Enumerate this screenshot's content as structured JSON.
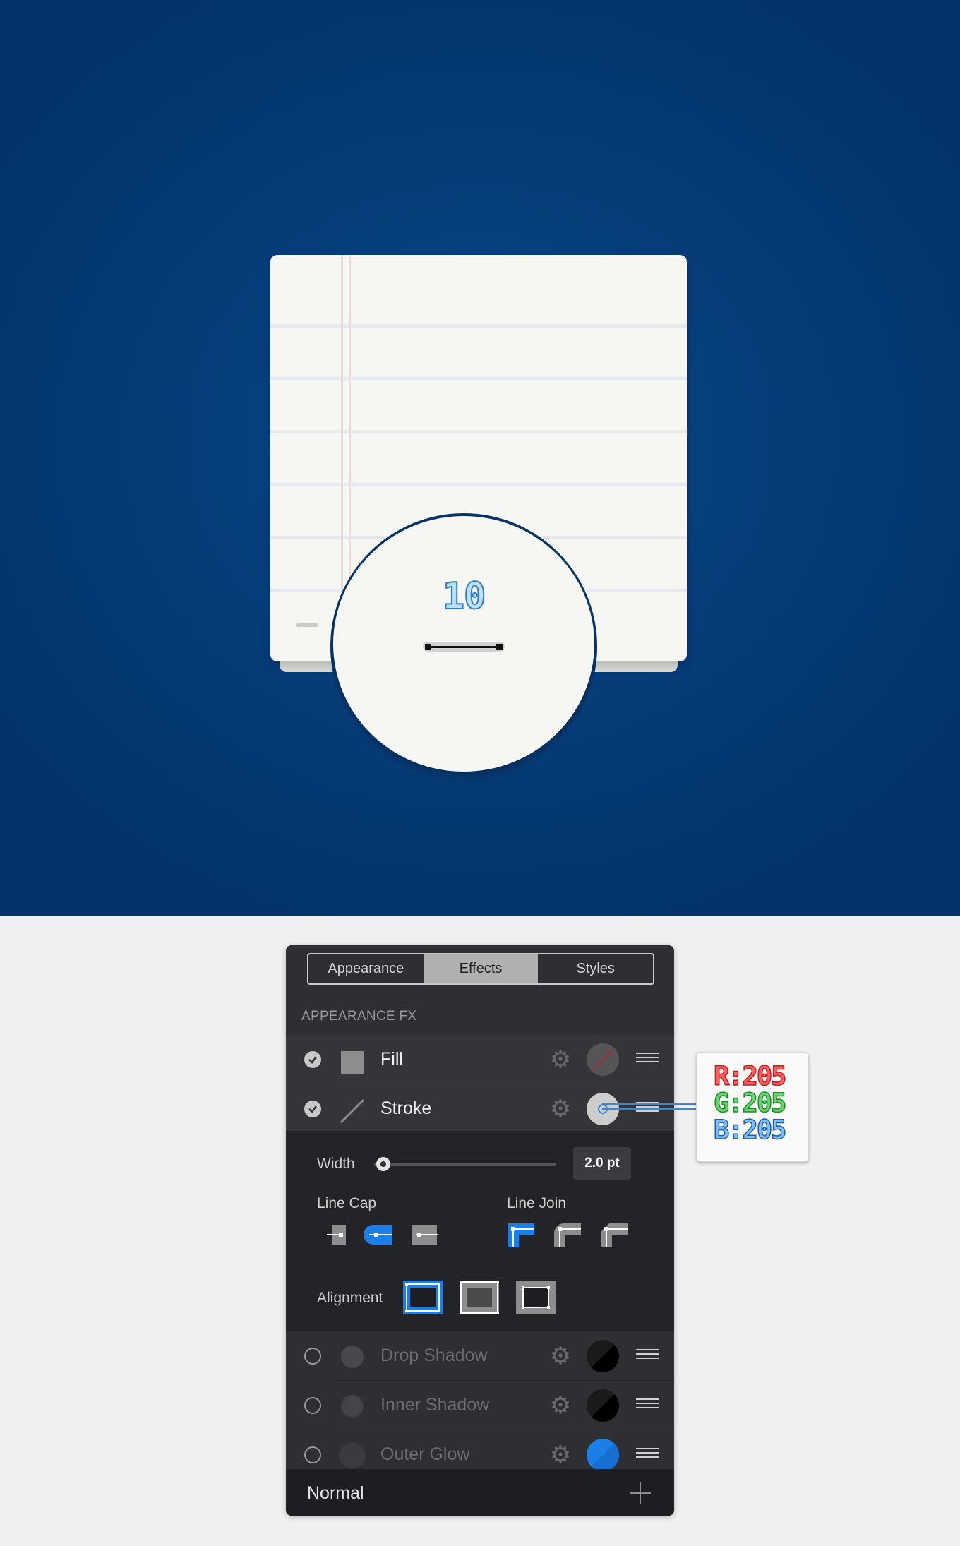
{
  "canvas": {
    "magnifier_value": "10"
  },
  "panel": {
    "tabs": [
      {
        "label": "Appearance",
        "active": false
      },
      {
        "label": "Effects",
        "active": true
      },
      {
        "label": "Styles",
        "active": false
      }
    ],
    "section_label": "APPEARANCE FX",
    "rows": [
      {
        "label": "Fill",
        "enabled": true
      },
      {
        "label": "Stroke",
        "enabled": true
      }
    ],
    "stroke_options": {
      "width_label": "Width",
      "width_value": "2.0 pt",
      "width_slider": 0.05,
      "line_cap_label": "Line Cap",
      "line_join_label": "Line Join",
      "alignment_label": "Alignment"
    },
    "effects": [
      {
        "label": "Drop Shadow",
        "enabled": false
      },
      {
        "label": "Inner Shadow",
        "enabled": false
      },
      {
        "label": "Outer Glow",
        "enabled": false
      }
    ],
    "blend_mode": "Normal"
  },
  "color_callout": {
    "r": "R:205",
    "g": "G:205",
    "b": "B:205"
  },
  "colors": {
    "accent": "#1a7fe8",
    "background_blue": "#063e7b",
    "stroke_color": "#cdcdcd",
    "panel_bg": "#2e2f33"
  }
}
